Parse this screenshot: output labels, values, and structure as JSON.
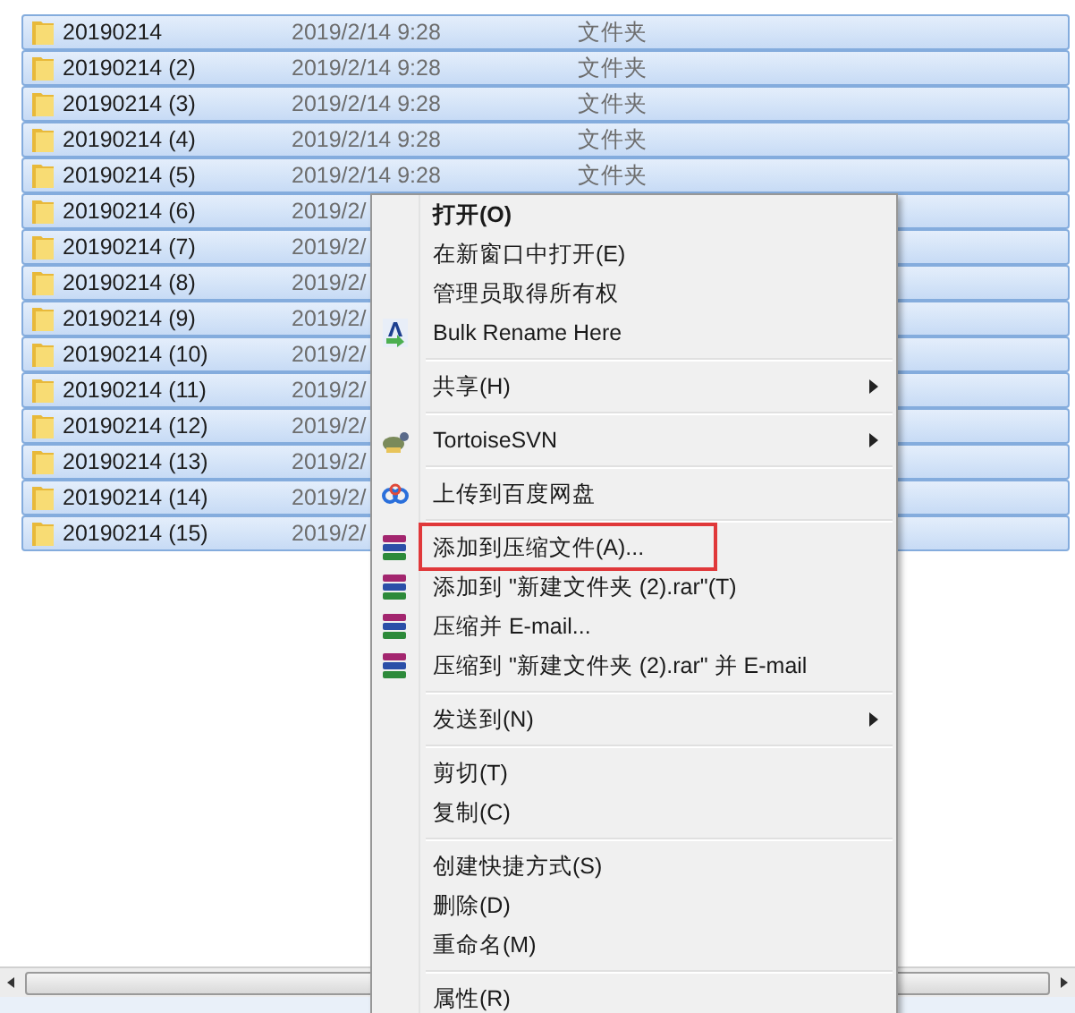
{
  "file_list": {
    "rows": [
      {
        "name": "20190214",
        "date": "2019/2/14 9:28",
        "type": "文件夹",
        "selected": true
      },
      {
        "name": "20190214 (2)",
        "date": "2019/2/14 9:28",
        "type": "文件夹",
        "selected": true
      },
      {
        "name": "20190214 (3)",
        "date": "2019/2/14 9:28",
        "type": "文件夹",
        "selected": true
      },
      {
        "name": "20190214 (4)",
        "date": "2019/2/14 9:28",
        "type": "文件夹",
        "selected": true
      },
      {
        "name": "20190214 (5)",
        "date": "2019/2/14 9:28",
        "type": "文件夹",
        "selected": true
      },
      {
        "name": "20190214 (6)",
        "date": "2019/2/",
        "selected": true
      },
      {
        "name": "20190214 (7)",
        "date": "2019/2/",
        "selected": true
      },
      {
        "name": "20190214 (8)",
        "date": "2019/2/",
        "selected": true
      },
      {
        "name": "20190214 (9)",
        "date": "2019/2/",
        "selected": true
      },
      {
        "name": "20190214 (10)",
        "date": "2019/2/",
        "selected": true
      },
      {
        "name": "20190214 (11)",
        "date": "2019/2/",
        "selected": true
      },
      {
        "name": "20190214 (12)",
        "date": "2019/2/",
        "selected": true
      },
      {
        "name": "20190214 (13)",
        "date": "2019/2/",
        "selected": true
      },
      {
        "name": "20190214 (14)",
        "date": "2019/2/",
        "selected": true
      },
      {
        "name": "20190214 (15)",
        "date": "2019/2/",
        "selected": true
      }
    ]
  },
  "context_menu": {
    "items": [
      {
        "kind": "text",
        "label": "打开(O)",
        "default": true,
        "submenu": false,
        "highlighted": false
      },
      {
        "kind": "text",
        "label": "在新窗口中打开(E)",
        "default": false,
        "submenu": false,
        "highlighted": false
      },
      {
        "kind": "text",
        "label": "管理员取得所有权",
        "default": false,
        "submenu": false,
        "highlighted": false
      },
      {
        "kind": "bulk-rename",
        "label": "Bulk Rename Here",
        "default": false,
        "submenu": false,
        "highlighted": false
      },
      {
        "kind": "separator"
      },
      {
        "kind": "text",
        "label": "共享(H)",
        "default": false,
        "submenu": true,
        "highlighted": false
      },
      {
        "kind": "separator"
      },
      {
        "kind": "svn",
        "label": "TortoiseSVN",
        "default": false,
        "submenu": true,
        "highlighted": false
      },
      {
        "kind": "separator"
      },
      {
        "kind": "cloud",
        "label": "上传到百度网盘",
        "default": false,
        "submenu": false,
        "highlighted": false
      },
      {
        "kind": "separator"
      },
      {
        "kind": "archive",
        "label": "添加到压缩文件(A)...",
        "default": false,
        "submenu": false,
        "highlighted": true
      },
      {
        "kind": "archive",
        "label": "添加到 \"新建文件夹 (2).rar\"(T)",
        "default": false,
        "submenu": false,
        "highlighted": false
      },
      {
        "kind": "archive",
        "label": "压缩并 E-mail...",
        "default": false,
        "submenu": false,
        "highlighted": false
      },
      {
        "kind": "archive",
        "label": "压缩到 \"新建文件夹 (2).rar\" 并 E-mail",
        "default": false,
        "submenu": false,
        "highlighted": false
      },
      {
        "kind": "separator"
      },
      {
        "kind": "text",
        "label": "发送到(N)",
        "default": false,
        "submenu": true,
        "highlighted": false
      },
      {
        "kind": "separator"
      },
      {
        "kind": "text",
        "label": "剪切(T)",
        "default": false,
        "submenu": false,
        "highlighted": false
      },
      {
        "kind": "text",
        "label": "复制(C)",
        "default": false,
        "submenu": false,
        "highlighted": false
      },
      {
        "kind": "separator"
      },
      {
        "kind": "text",
        "label": "创建快捷方式(S)",
        "default": false,
        "submenu": false,
        "highlighted": false
      },
      {
        "kind": "text",
        "label": "删除(D)",
        "default": false,
        "submenu": false,
        "highlighted": false
      },
      {
        "kind": "text",
        "label": "重命名(M)",
        "default": false,
        "submenu": false,
        "highlighted": false
      },
      {
        "kind": "separator"
      },
      {
        "kind": "text",
        "label": "属性(R)",
        "default": false,
        "submenu": false,
        "highlighted": false
      }
    ]
  }
}
